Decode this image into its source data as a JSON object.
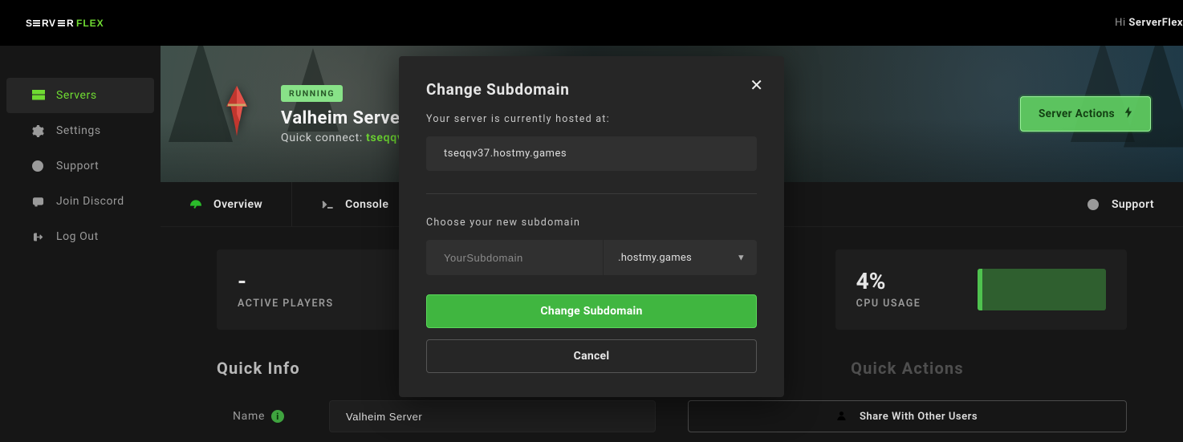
{
  "brand": {
    "part1": "SERVER",
    "part2": "FLEX"
  },
  "greeting": {
    "hi": "Hi ",
    "name": "ServerFlex"
  },
  "sidebar": {
    "items": [
      {
        "label": "Servers"
      },
      {
        "label": "Settings"
      },
      {
        "label": "Support"
      },
      {
        "label": "Join Discord"
      },
      {
        "label": "Log Out"
      }
    ]
  },
  "hero": {
    "status": "RUNNING",
    "title": "Valheim Server",
    "quick_label": "Quick connect: ",
    "quick_value": "tseqqv",
    "actions_label": "Server Actions"
  },
  "tabs": {
    "overview": "Overview",
    "console": "Console",
    "support": "Support"
  },
  "stats": {
    "players": {
      "value": "-",
      "label": "ACTIVE PLAYERS"
    },
    "cpu": {
      "value": "4%",
      "label": "CPU USAGE",
      "fill_pct": 4
    }
  },
  "quick_info": {
    "title": "Quick Info",
    "name_label": "Name",
    "name_value": "Valheim Server"
  },
  "quick_actions": {
    "title": "Quick Actions",
    "share": "Share With Other Users"
  },
  "modal": {
    "title": "Change Subdomain",
    "current_label": "Your server is currently hosted at:",
    "current_value": "tseqqv37.hostmy.games",
    "choose_label": "Choose your new subdomain",
    "placeholder": "YourSubdomain",
    "domain": ".hostmy.games",
    "submit": "Change Subdomain",
    "cancel": "Cancel"
  }
}
